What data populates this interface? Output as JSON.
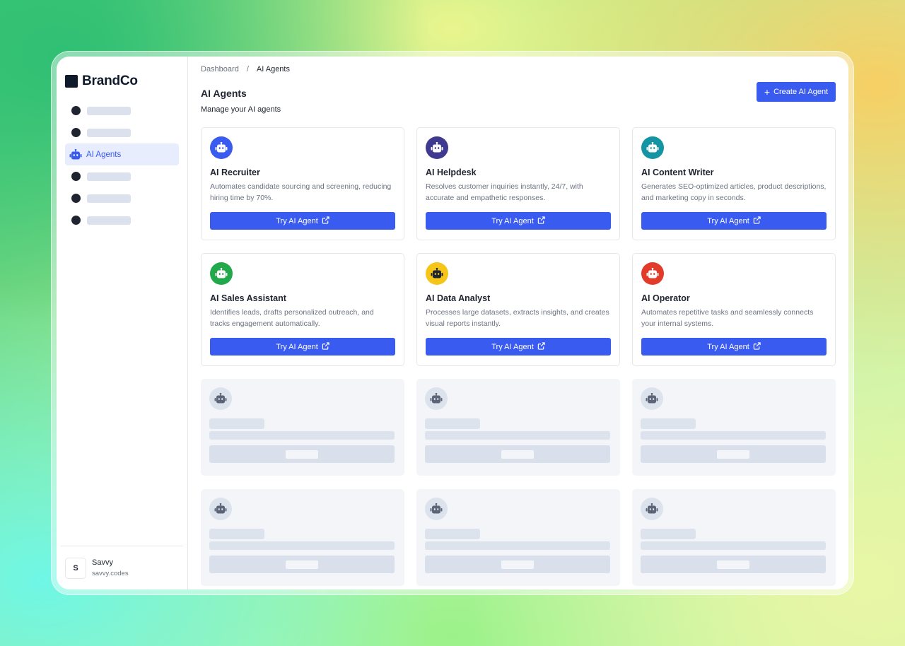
{
  "app": {
    "brand": "BrandCo"
  },
  "breadcrumb": {
    "root": "Dashboard",
    "separator": "/",
    "current": "AI Agents"
  },
  "sidebar": {
    "items": [
      {
        "placeholder": true
      },
      {
        "placeholder": true
      },
      {
        "label": "AI Agents",
        "icon": "robot-icon",
        "active": true
      },
      {
        "placeholder": true
      },
      {
        "placeholder": true
      },
      {
        "placeholder": true
      }
    ],
    "user": {
      "initial": "S",
      "name": "Savvy",
      "subtitle": "savvy.codes"
    }
  },
  "header": {
    "title": "AI Agents",
    "subtitle": "Manage your AI agents",
    "create_button": "Create AI Agent",
    "create_icon": "plus-icon"
  },
  "colors": {
    "accent": "#3a5bf0",
    "recruiter": "#3a5bf0",
    "helpdesk": "#3f3a8f",
    "content_writer": "#1595a3",
    "sales": "#21a84a",
    "data_analyst": "#f5c518",
    "operator": "#e23b2a"
  },
  "agents": [
    {
      "name": "AI Recruiter",
      "description": "Automates candidate sourcing and screening, reducing hiring time by 70%.",
      "button": "Try AI Agent",
      "color": "#3a5bf0",
      "icon": "robot-icon"
    },
    {
      "name": "AI Helpdesk",
      "description": "Resolves customer inquiries instantly, 24/7, with accurate and empathetic responses.",
      "button": "Try AI Agent",
      "color": "#3f3a8f",
      "icon": "robot-icon"
    },
    {
      "name": "AI Content Writer",
      "description": "Generates SEO-optimized articles, product descriptions, and marketing copy in seconds.",
      "button": "Try AI Agent",
      "color": "#1595a3",
      "icon": "robot-icon"
    },
    {
      "name": "AI Sales Assistant",
      "description": "Identifies leads, drafts personalized outreach, and tracks engagement automatically.",
      "button": "Try AI Agent",
      "color": "#21a84a",
      "icon": "robot-icon"
    },
    {
      "name": "AI Data Analyst",
      "description": "Processes large datasets, extracts insights, and creates visual reports instantly.",
      "button": "Try AI Agent",
      "color": "#f5c518",
      "icon": "robot-icon"
    },
    {
      "name": "AI Operator",
      "description": "Automates repetitive tasks and seamlessly connects your internal systems.",
      "button": "Try AI Agent",
      "color": "#e23b2a",
      "icon": "robot-icon"
    }
  ],
  "skeleton_cards": 6
}
